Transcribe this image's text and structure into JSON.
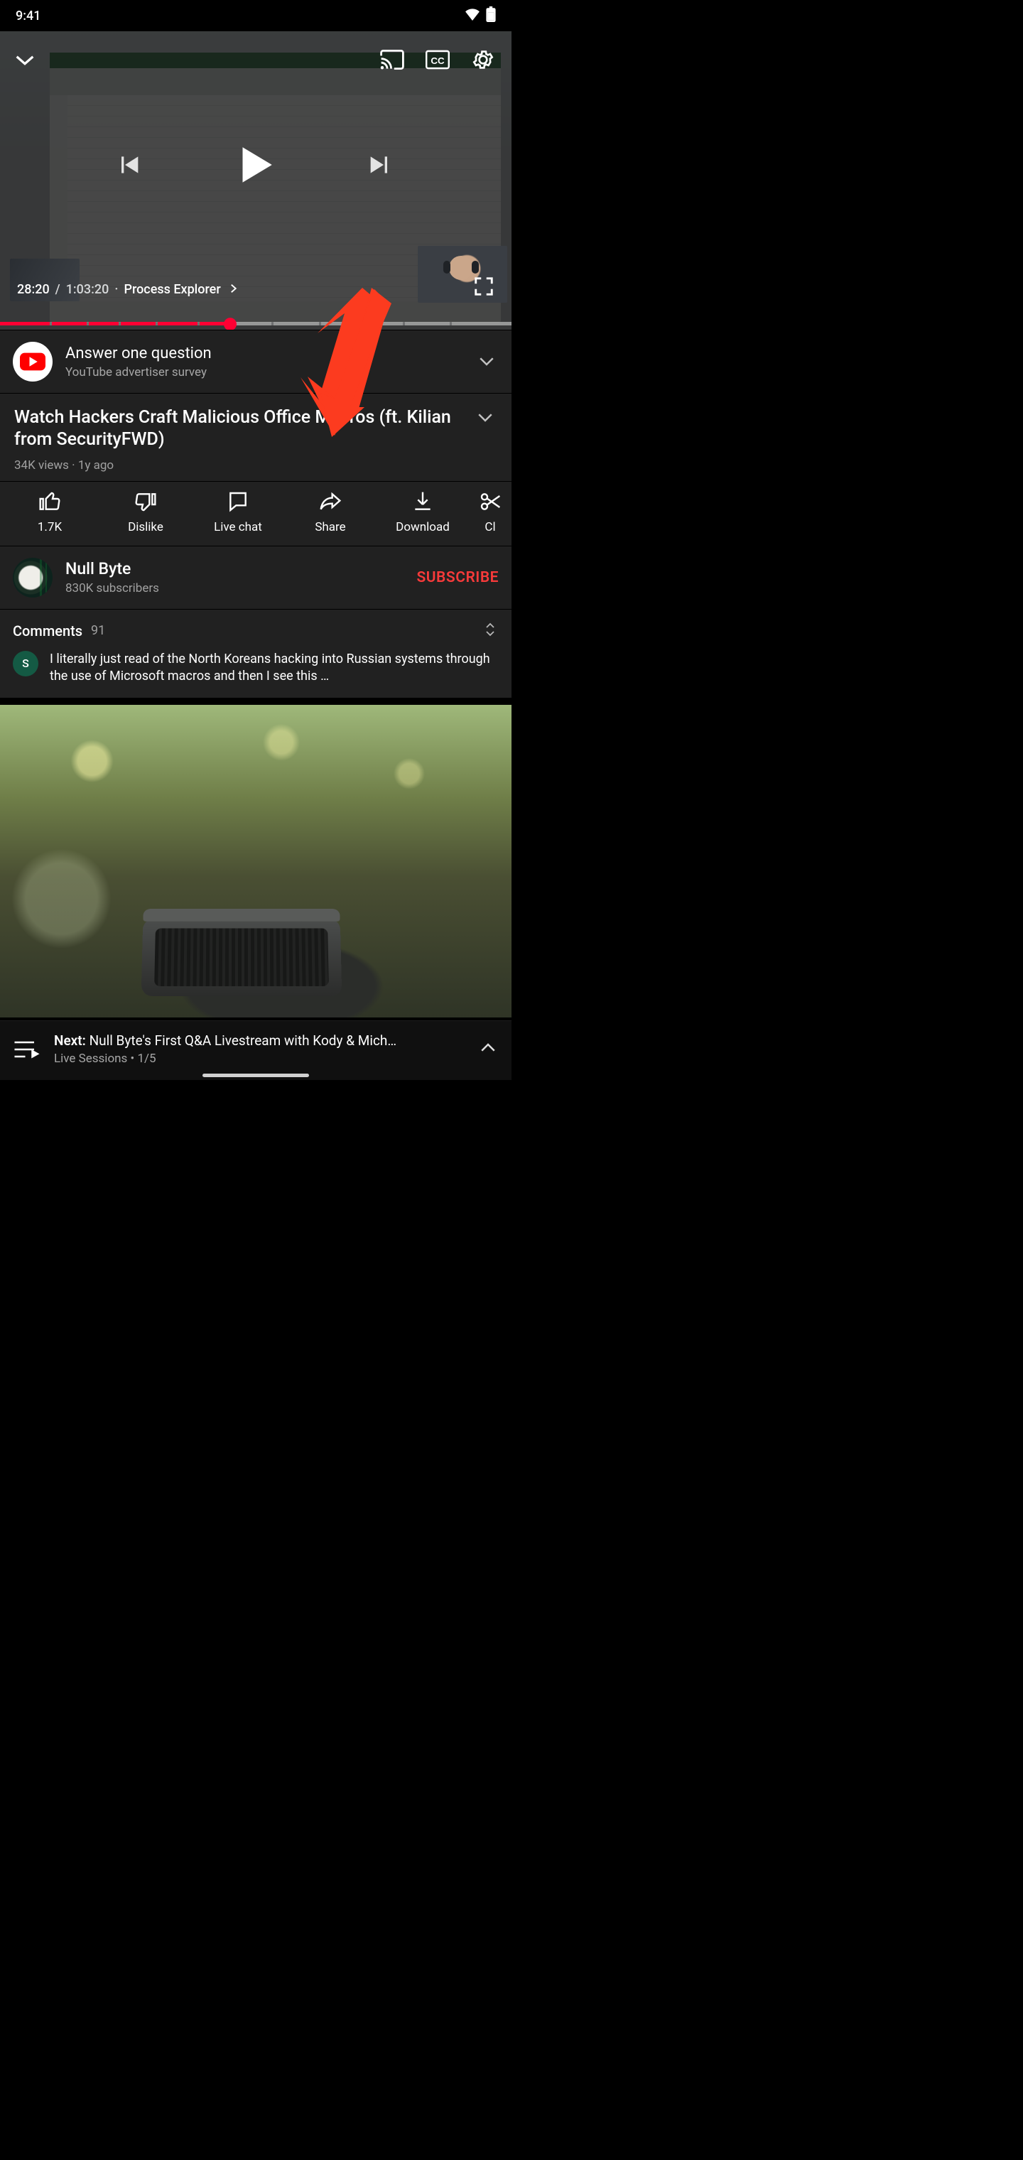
{
  "status": {
    "time": "9:41"
  },
  "player": {
    "current_time": "28:20",
    "duration": "1:03:20",
    "chapter": "Process Explorer",
    "progress_percent": 45
  },
  "survey": {
    "title": "Answer one question",
    "subtitle": "YouTube advertiser survey"
  },
  "video": {
    "title": "Watch Hackers Craft Malicious Office Macros (ft. Kilian from SecurityFWD)",
    "views": "34K views",
    "age": "1y ago"
  },
  "actions": {
    "like_label": "1.7K",
    "dislike_label": "Dislike",
    "livechat_label": "Live chat",
    "share_label": "Share",
    "download_label": "Download",
    "clip_label": "Cl"
  },
  "channel": {
    "name": "Null Byte",
    "subs": "830K subscribers",
    "subscribe_label": "SUBSCRIBE"
  },
  "comments": {
    "label": "Comments",
    "count": "91",
    "top_avatar_letter": "S",
    "top_text": "I literally just read of the North Koreans hacking into Russian systems through the use of Microsoft macros and then I see this …"
  },
  "upnext": {
    "prefix": "Next:",
    "title": "Null Byte's First Q&A Livestream with Kody & Mich…",
    "playlist": "Live Sessions",
    "position": "1/5"
  }
}
